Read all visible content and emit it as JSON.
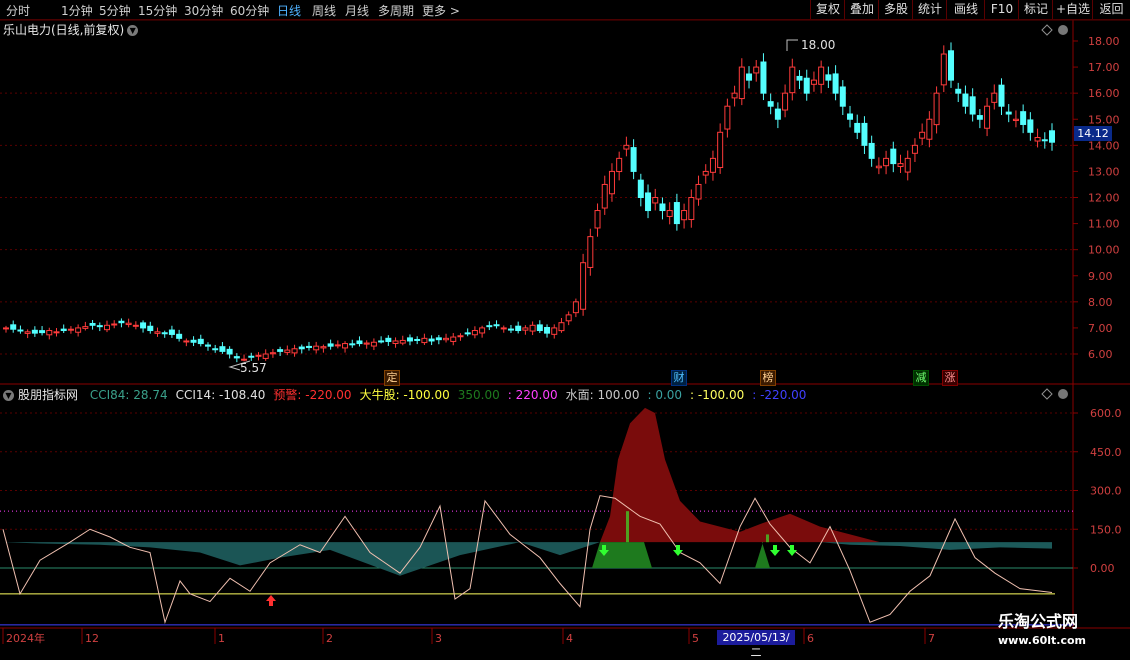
{
  "toolbar": {
    "periods": [
      "分时",
      "1分钟",
      "5分钟",
      "15分钟",
      "30分钟",
      "60分钟",
      "日线",
      "周线",
      "月线",
      "多周期",
      "更多 >"
    ],
    "active_period": "日线",
    "right_buttons": [
      "复权",
      "叠加",
      "多股",
      "统计",
      "画线",
      "F10",
      "标记",
      "+自选",
      "返回"
    ]
  },
  "main_chart": {
    "title": "乐山电力(日线,前复权)",
    "high_marker": "18.00",
    "low_marker": "5.57",
    "current_price": "14.12",
    "y_ticks": [
      "18.00",
      "17.00",
      "16.00",
      "15.00",
      "14.00",
      "13.00",
      "12.00",
      "11.00",
      "10.00",
      "9.00",
      "8.00",
      "7.00",
      "6.00"
    ],
    "events": [
      "定",
      "财",
      "榜",
      "减",
      "涨"
    ]
  },
  "indicator": {
    "name": "股朋指标网",
    "values": [
      {
        "label": "CCI84: 28.74",
        "color": "#3aa08a"
      },
      {
        "label": "CCI14: -108.40",
        "color": "#e0e0e0"
      },
      {
        "label": "预警: -220.00",
        "color": "#ff3030"
      },
      {
        "label": "大牛股: -100.00",
        "color": "#ffff40"
      },
      {
        "label": "350.00",
        "color": "#1e7a1e"
      },
      {
        "label": ": 220.00",
        "color": "#ff40ff"
      },
      {
        "label": "水面: 100.00",
        "color": "#c8c8c8"
      },
      {
        "label": ": 0.00",
        "color": "#3aa0a0"
      },
      {
        "label": ": -100.00",
        "color": "#ffff60"
      },
      {
        "label": ": -220.00",
        "color": "#4040ff"
      }
    ],
    "y_ticks": [
      "600.0",
      "450.0",
      "300.0",
      "150.0",
      "0.00"
    ]
  },
  "x_axis": {
    "labels": [
      "2024年",
      "12",
      "1",
      "2",
      "3",
      "4",
      "5",
      "6",
      "7"
    ],
    "cursor_date": "2025/05/13/二"
  },
  "watermark": {
    "line1": "乐淘公式网",
    "line2": "www.60lt.com"
  },
  "chart_data": {
    "type": "candlestick",
    "y_range": [
      5.2,
      18.5
    ],
    "indicator_range": [
      -220,
      650
    ],
    "closes": [
      7.0,
      6.95,
      6.9,
      6.85,
      6.8,
      6.82,
      6.9,
      6.85,
      6.9,
      6.95,
      7.0,
      7.05,
      7.1,
      7.05,
      7.1,
      7.15,
      7.2,
      7.18,
      7.1,
      7.0,
      6.9,
      6.85,
      6.8,
      6.75,
      6.6,
      6.5,
      6.45,
      6.4,
      6.3,
      6.2,
      6.1,
      6.0,
      5.85,
      5.8,
      5.9,
      5.95,
      6.0,
      6.05,
      6.1,
      6.15,
      6.2,
      6.2,
      6.25,
      6.3,
      6.28,
      6.3,
      6.35,
      6.4,
      6.38,
      6.4,
      6.42,
      6.45,
      6.5,
      6.48,
      6.5,
      6.52,
      6.5,
      6.55,
      6.6,
      6.5,
      6.55,
      6.6,
      6.65,
      6.7,
      6.8,
      6.9,
      7.0,
      7.05,
      7.1,
      7.0,
      6.95,
      6.9,
      7.0,
      7.1,
      6.9,
      6.8,
      7.0,
      7.2,
      7.5,
      8.0,
      9.5,
      10.5,
      11.5,
      12.5,
      13.0,
      13.5,
      14.0,
      13.0,
      12.0,
      11.5,
      12.0,
      11.5,
      11.5,
      11.0,
      11.5,
      12.0,
      12.5,
      13.0,
      13.5,
      14.5,
      15.5,
      16.0,
      17.0,
      16.5,
      17.0,
      16.0,
      15.5,
      15.0,
      16.0,
      17.0,
      16.5,
      16.0,
      16.5,
      17.0,
      16.5,
      16.0,
      15.5,
      15.0,
      14.5,
      14.0,
      13.5,
      13.2,
      13.5,
      13.3,
      13.3,
      13.5,
      14.0,
      14.5,
      15.0,
      16.0,
      17.5,
      16.5,
      16.0,
      15.5,
      15.2,
      15.0,
      15.5,
      16.0,
      15.5,
      15.2,
      15.0,
      14.8,
      14.5,
      14.3,
      14.2,
      14.12
    ]
  }
}
